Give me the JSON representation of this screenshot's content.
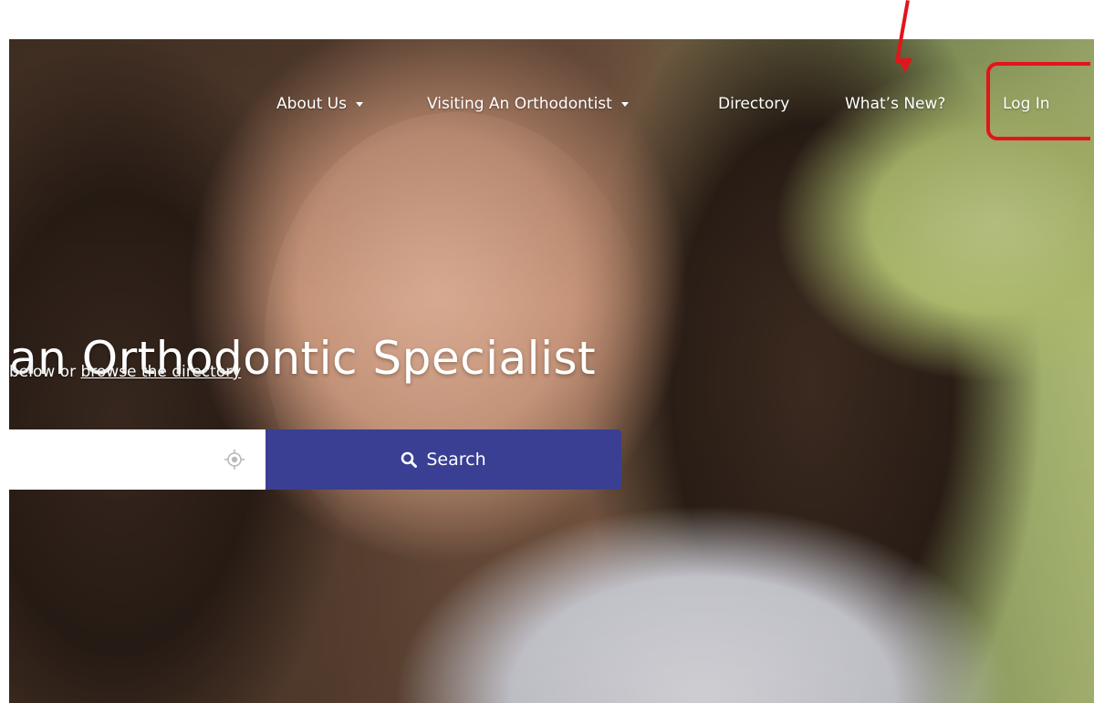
{
  "nav": {
    "items": [
      {
        "label": "About Us",
        "has_dropdown": true
      },
      {
        "label": "Visiting An Orthodontist",
        "has_dropdown": true
      },
      {
        "label": "Directory",
        "has_dropdown": false
      },
      {
        "label": "What’s New?",
        "has_dropdown": false
      },
      {
        "label": "Log In",
        "has_dropdown": false
      }
    ]
  },
  "hero": {
    "headline": "an Orthodontic Specialist",
    "subline_prefix": "below or ",
    "subline_link": "browse the directory"
  },
  "search": {
    "input_value": "",
    "input_placeholder": "",
    "button_label": "Search",
    "button_color": "#3a3f94"
  },
  "annotation": {
    "highlight_color": "#e3141b",
    "highlighted_item": "Log In"
  },
  "icons": {
    "geolocate": "crosshair-icon",
    "search": "magnifier-icon",
    "dropdown": "caret-down-icon"
  }
}
